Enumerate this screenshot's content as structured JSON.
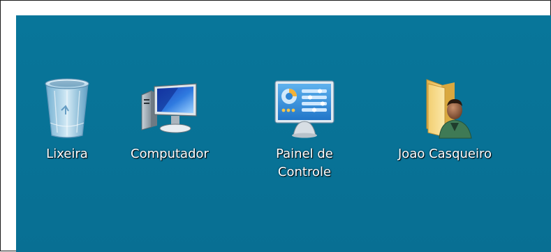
{
  "desktop": {
    "background_color": "#08739a",
    "icons": [
      {
        "label": "Lixeira",
        "icon": "recycle-bin-icon"
      },
      {
        "label": "Computador",
        "icon": "computer-icon"
      },
      {
        "label": "Painel de\nControle",
        "icon": "control-panel-icon"
      },
      {
        "label": "Joao Casqueiro",
        "icon": "user-folder-icon"
      }
    ]
  }
}
